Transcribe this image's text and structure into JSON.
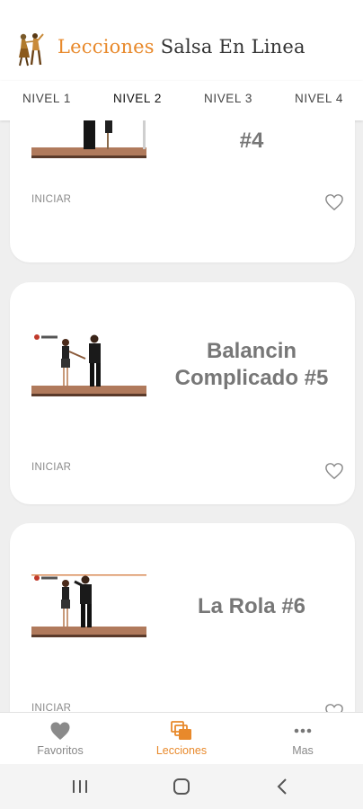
{
  "app": {
    "title_accent": "Lecciones",
    "title_rest": "Salsa En Linea"
  },
  "tabs": [
    {
      "label": "NIVEL 1"
    },
    {
      "label": "NIVEL 2",
      "active": true
    },
    {
      "label": "NIVEL 3"
    },
    {
      "label": "NIVEL 4"
    }
  ],
  "lessons": [
    {
      "title": "#4",
      "action": "INICIAR"
    },
    {
      "title": "Balancin Complicado #5",
      "action": "INICIAR"
    },
    {
      "title": "La Rola #6",
      "action": "INICIAR"
    }
  ],
  "bottom_nav": [
    {
      "label": "Favoritos",
      "icon": "heart-icon"
    },
    {
      "label": "Lecciones",
      "icon": "lessons-icon",
      "active": true
    },
    {
      "label": "Mas",
      "icon": "more-icon"
    }
  ],
  "colors": {
    "accent": "#e8892b",
    "background": "#efefef",
    "card": "#ffffff",
    "title_text": "#777777"
  }
}
